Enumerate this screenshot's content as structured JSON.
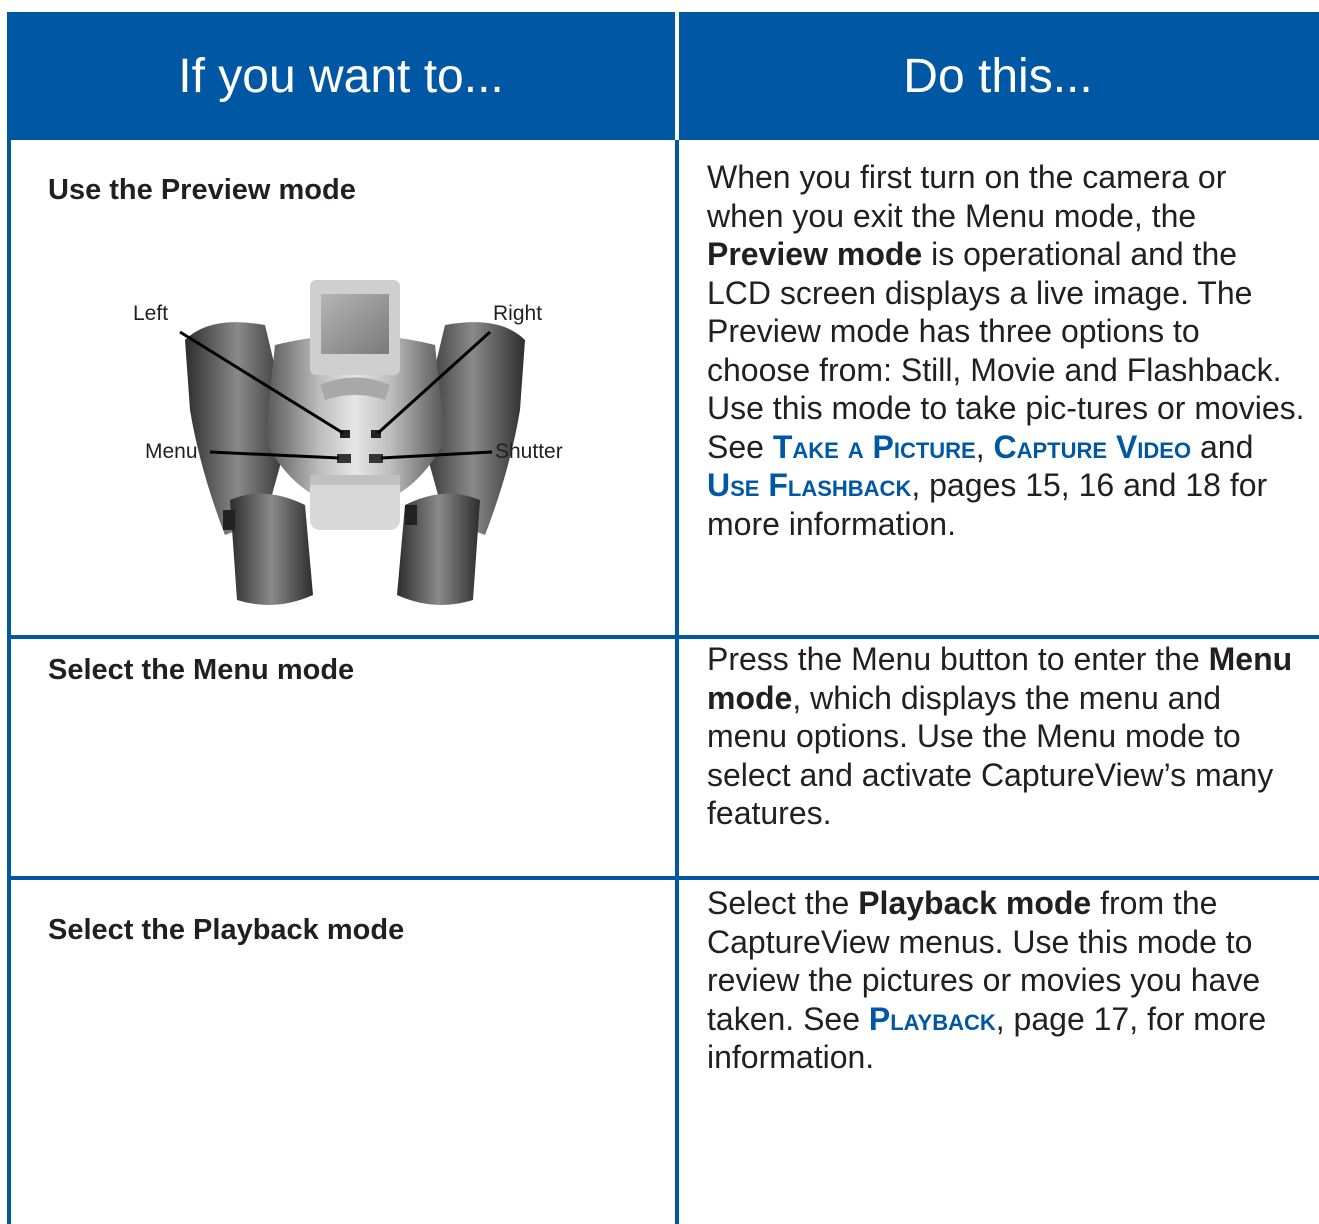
{
  "header": {
    "left_title": "If you want to...",
    "right_title": "Do this..."
  },
  "rows": [
    {
      "action": "Use the Preview mode",
      "desc_1": "When you first turn on the camera or when you exit the Menu mode, the ",
      "desc_bold_1": "Preview mode",
      "desc_2": " is operational and the LCD screen displays a live image. The Preview mode has three options to choose from: Still, Movie and Flashback. Use this mode to take pic-tures or movies. See ",
      "xref_1": "Take a Picture",
      "sep_1": ", ",
      "xref_2": "Capture Video",
      "sep_2": " and ",
      "xref_3": "Use Flashback",
      "desc_3": ", pages 15, 16 and 18 for more information."
    },
    {
      "action": "Select the Menu mode",
      "desc_1": "Press the Menu button to enter the ",
      "desc_bold_1": "Menu mode",
      "desc_2": ", which displays the menu and menu options. Use the Menu mode to select and activate CaptureView’s many features."
    },
    {
      "action": "Select the Playback mode",
      "desc_1": "Select the ",
      "desc_bold_1": "Playback mode",
      "desc_2": " from the CaptureView menus. Use this mode to review the pictures or movies you have taken. See ",
      "xref_1": "Playback",
      "desc_3": ", page 17, for more information."
    }
  ],
  "camera_labels": {
    "left": "Left",
    "right": "Right",
    "menu": "Menu",
    "shutter": "Shutter"
  },
  "colors": {
    "accent_blue": "#0057a4",
    "text": "#231f20"
  }
}
